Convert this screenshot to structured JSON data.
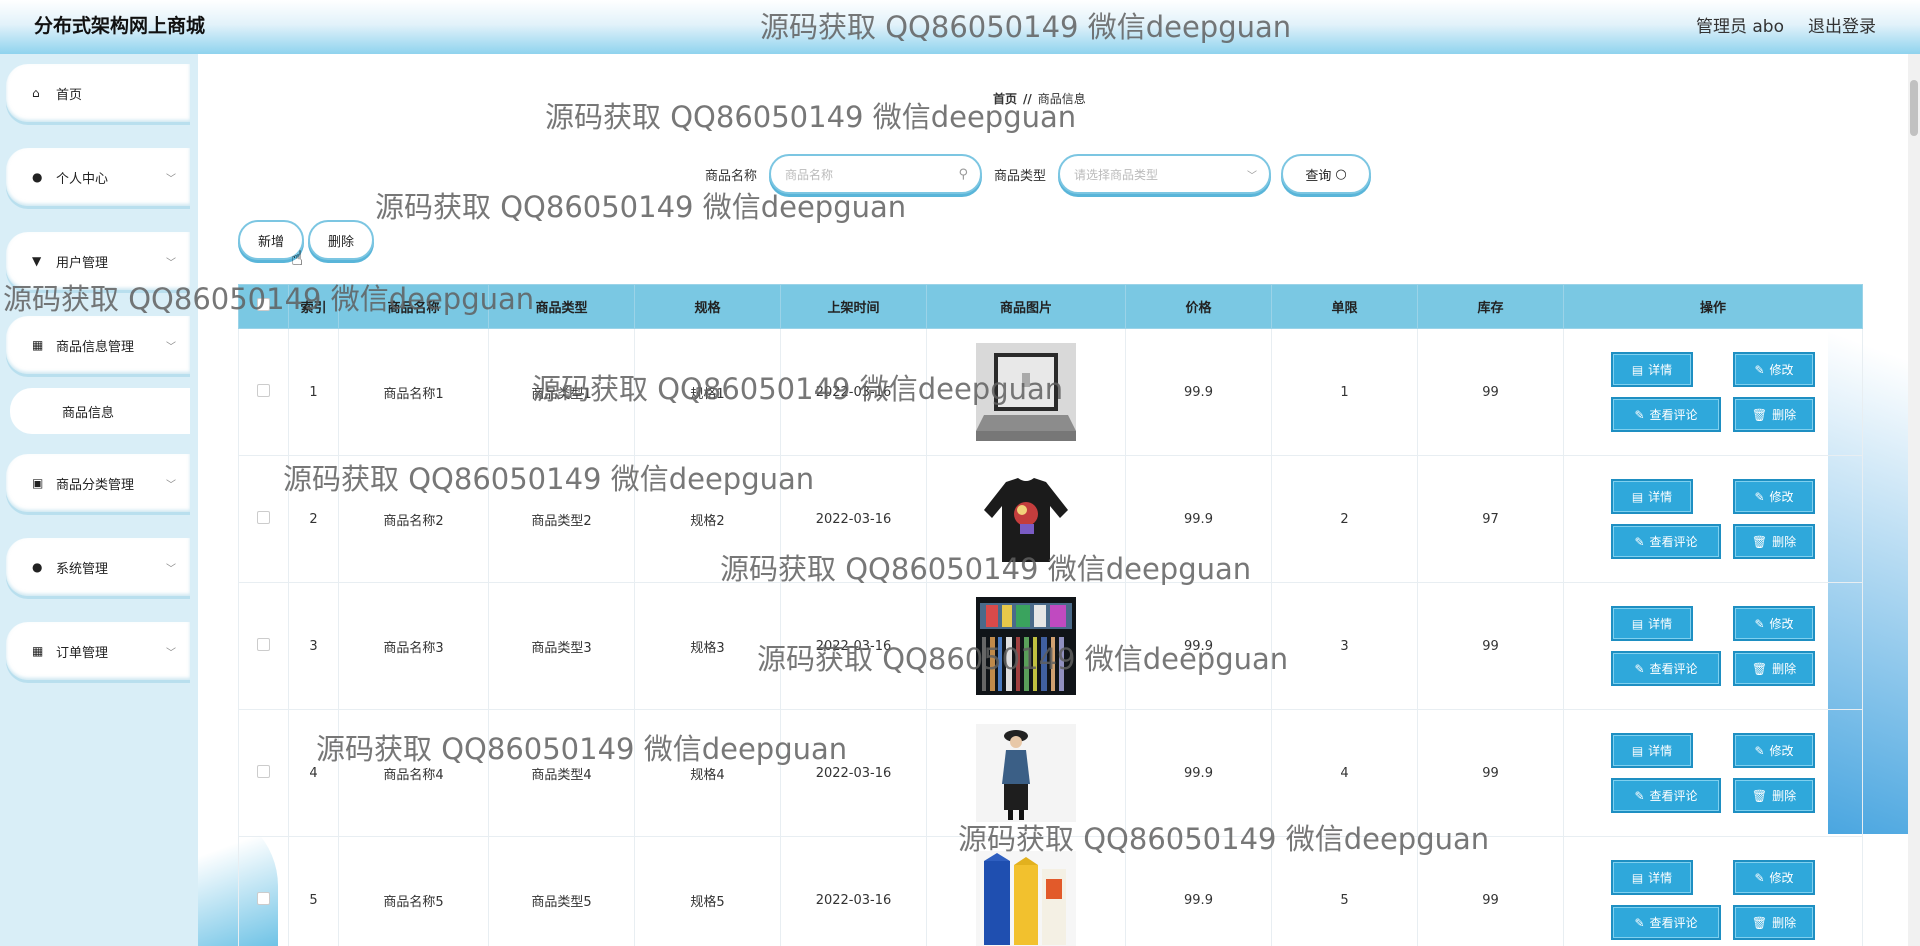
{
  "header": {
    "brand": "分布式架构网上商城",
    "user": "管理员 abo",
    "logout": "退出登录"
  },
  "sidebar": {
    "items": [
      {
        "label": "首页",
        "icon": "home-icon"
      },
      {
        "label": "个人中心",
        "icon": "user-icon"
      },
      {
        "label": "用户管理",
        "icon": "user-manage-icon"
      },
      {
        "label": "商品信息管理",
        "icon": "grid-icon"
      },
      {
        "label": "商品分类管理",
        "icon": "clipboard-icon"
      },
      {
        "label": "系统管理",
        "icon": "user-icon"
      },
      {
        "label": "订单管理",
        "icon": "grid-icon"
      }
    ],
    "submenu": "商品信息"
  },
  "breadcrumb": {
    "home": "首页",
    "sep": "//",
    "current": "商品信息"
  },
  "search": {
    "name_label": "商品名称",
    "name_placeholder": "商品名称",
    "type_label": "商品类型",
    "type_placeholder": "请选择商品类型",
    "query_button": "查询"
  },
  "actions": {
    "add": "新增",
    "delete": "删除"
  },
  "table": {
    "columns": [
      "索引",
      "商品名称",
      "商品类型",
      "规格",
      "上架时间",
      "商品图片",
      "价格",
      "单限",
      "库存",
      "操作"
    ],
    "rows": [
      {
        "index": "1",
        "name": "商品名称1",
        "type": "商品类型1",
        "spec": "规格1",
        "date": "2022-03-16",
        "price": "99.9",
        "limit": "1",
        "stock": "99",
        "image": "laptop"
      },
      {
        "index": "2",
        "name": "商品名称2",
        "type": "商品类型2",
        "spec": "规格2",
        "date": "2022-03-16",
        "price": "99.9",
        "limit": "2",
        "stock": "97",
        "image": "sweater"
      },
      {
        "index": "3",
        "name": "商品名称3",
        "type": "商品类型3",
        "spec": "规格3",
        "date": "2022-03-16",
        "price": "99.9",
        "limit": "3",
        "stock": "99",
        "image": "books"
      },
      {
        "index": "4",
        "name": "商品名称4",
        "type": "商品类型4",
        "spec": "规格4",
        "date": "2022-03-16",
        "price": "99.9",
        "limit": "4",
        "stock": "99",
        "image": "fashion"
      },
      {
        "index": "5",
        "name": "商品名称5",
        "type": "商品类型5",
        "spec": "规格5",
        "date": "2022-03-16",
        "price": "99.9",
        "limit": "5",
        "stock": "99",
        "image": "cartons"
      }
    ],
    "op_labels": {
      "detail": "详情",
      "edit": "修改",
      "comments": "查看评论",
      "delete": "删除"
    }
  },
  "watermark": "源码获取 QQ86050149 微信deepguan"
}
